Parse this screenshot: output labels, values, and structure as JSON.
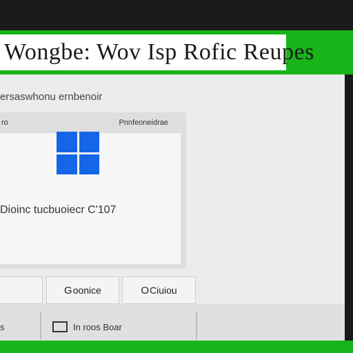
{
  "header": {
    "title": "Wongbe: Wov Isp Rofic Reupes"
  },
  "main": {
    "subtitle": "ersaswhonu ernbenoir",
    "panel": {
      "left_label": "ro",
      "right_label": "Pnnfeoneidrae",
      "device_text": "Dioinc tucbuoiecr C'107"
    }
  },
  "buttons": {
    "left_label": "",
    "g_glyph": "G",
    "g_label": "oonice",
    "o_glyph": "O",
    "o_label": "Ciuiou"
  },
  "bottom": {
    "left_label": "s",
    "right_label": "In roos Boar"
  },
  "colors": {
    "accent": "#17b41a",
    "windows_blue": "#1565e8",
    "background_dark": "#1a1a1a",
    "content_bg": "#ececec"
  },
  "icons": {
    "logo": "windows-logo-icon",
    "bottom": "monitor-icon"
  }
}
